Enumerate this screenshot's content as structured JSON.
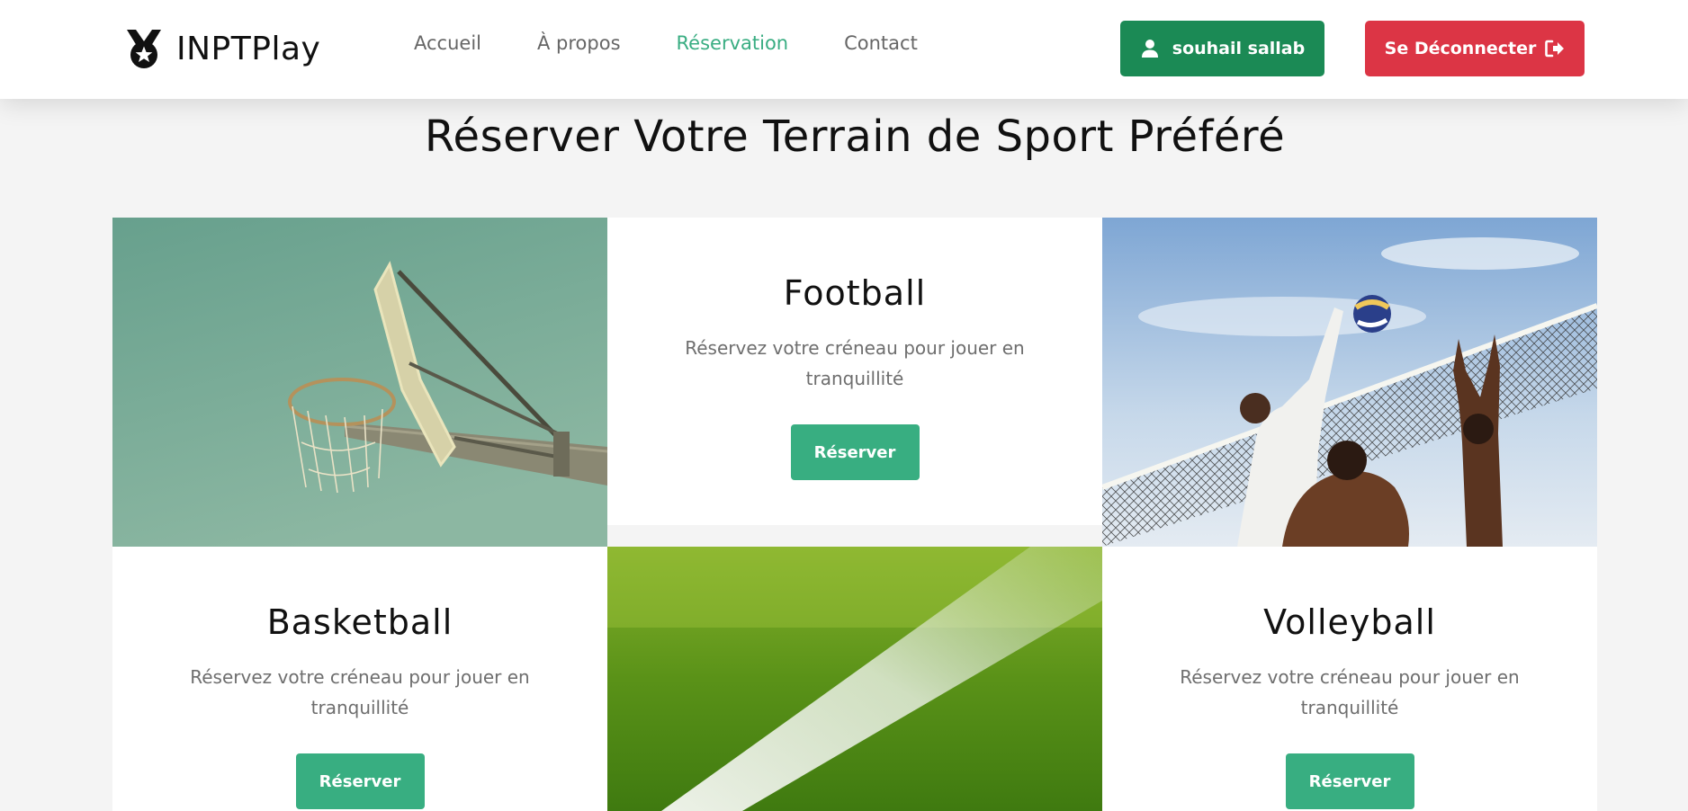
{
  "brand": {
    "name": "INPTPlay",
    "icon": "medal-icon"
  },
  "nav": {
    "links": [
      {
        "label": "Accueil"
      },
      {
        "label": "À propos"
      },
      {
        "label": "Réservation",
        "active": true
      },
      {
        "label": "Contact"
      }
    ]
  },
  "user": {
    "name": "souhail sallab",
    "icon": "user-icon"
  },
  "logout": {
    "label": "Se Déconnecter",
    "icon": "sign-out-icon"
  },
  "page": {
    "title": "Réserver Votre Terrain de Sport Préféré"
  },
  "sports": [
    {
      "title": "Football",
      "description": "Réservez votre créneau pour jouer en tranquillité",
      "button": "Réserver",
      "image": "football-pitch-grass"
    },
    {
      "title": "Basketball",
      "description": "Réservez votre créneau pour jouer en tranquillité",
      "button": "Réserver",
      "image": "basketball-hoop"
    },
    {
      "title": "Volleyball",
      "description": "Réservez votre créneau pour jouer en tranquillité",
      "button": "Réserver",
      "image": "beach-volleyball-players"
    }
  ],
  "colors": {
    "primary": "#38ae81",
    "user_button": "#1b8a55",
    "logout_button": "#dc3545",
    "active_link": "#39ad82"
  }
}
